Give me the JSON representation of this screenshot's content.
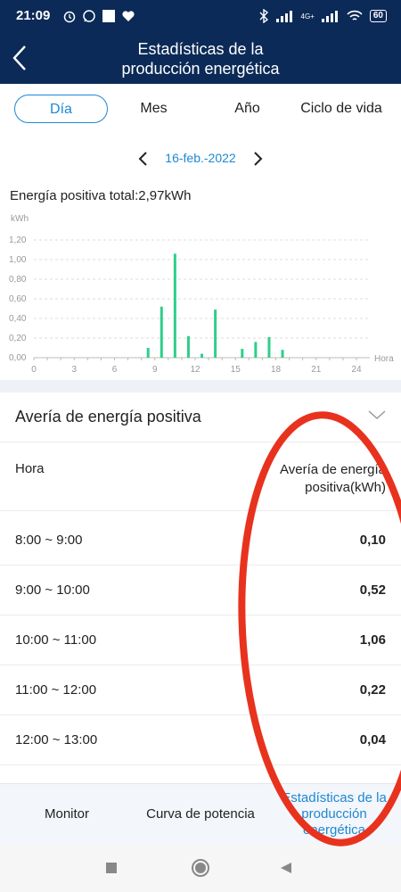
{
  "status_bar": {
    "time": "21:09",
    "battery": "60",
    "network": "4G+"
  },
  "header": {
    "title_line1": "Estadísticas de la",
    "title_line2": "producción energética"
  },
  "tabs": [
    {
      "label": "Día",
      "active": true
    },
    {
      "label": "Mes",
      "active": false
    },
    {
      "label": "Año",
      "active": false
    },
    {
      "label": "Ciclo de vida",
      "active": false
    }
  ],
  "date": "16-feb.-2022",
  "total_label": "Energía positiva total:2,97kWh",
  "chart_data": {
    "type": "bar",
    "ylabel": "kWh",
    "xlabel": "Hora",
    "ylim": [
      0,
      1.2
    ],
    "xlim": [
      0,
      24
    ],
    "yticks": [
      "0,00",
      "0,20",
      "0,40",
      "0,60",
      "0,80",
      "1,00",
      "1,20"
    ],
    "xticks": [
      "0",
      "3",
      "6",
      "9",
      "12",
      "15",
      "18",
      "21",
      "24"
    ],
    "x": [
      8.5,
      9.5,
      10.5,
      11.5,
      12.5,
      13.5,
      15.5,
      16.5,
      17.5,
      18.5
    ],
    "values": [
      0.1,
      0.52,
      1.06,
      0.22,
      0.04,
      0.49,
      0.09,
      0.16,
      0.21,
      0.08
    ],
    "color": "#2ecf8a"
  },
  "breakdown": {
    "title": "Avería de energía positiva",
    "col_hour": "Hora",
    "col_value": "Avería de energía positiva(kWh)",
    "rows": [
      {
        "hour": "8:00 ~ 9:00",
        "value": "0,10"
      },
      {
        "hour": "9:00 ~ 10:00",
        "value": "0,52"
      },
      {
        "hour": "10:00 ~ 11:00",
        "value": "1,06"
      },
      {
        "hour": "11:00 ~ 12:00",
        "value": "0,22"
      },
      {
        "hour": "12:00 ~ 13:00",
        "value": "0,04"
      }
    ]
  },
  "bottom_nav": [
    {
      "label": "Monitor",
      "active": false
    },
    {
      "label": "Curva de potencia",
      "active": false
    },
    {
      "label": "Estadísticas de la producción energética",
      "active": true
    }
  ],
  "colors": {
    "header_bg": "#0b2a57",
    "accent": "#1e88d3",
    "bar": "#2ecf8a",
    "annotation": "#e8321e"
  }
}
